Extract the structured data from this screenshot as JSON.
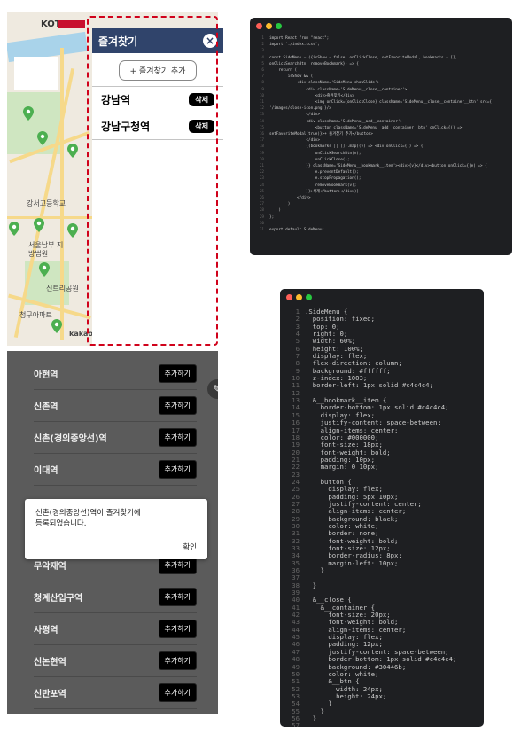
{
  "side_menu": {
    "title": "즐겨찾기",
    "close_icon": "close-icon",
    "add_button": "+ 즐겨찾기 추가",
    "favorites": [
      {
        "name": "강남역",
        "delete": "삭제"
      },
      {
        "name": "강남구청역",
        "delete": "삭제"
      }
    ]
  },
  "map": {
    "logo": "KOTI",
    "labels": [
      "강서고등학교",
      "서울남부 지방법원",
      "신트리공원",
      "청구아파트",
      "kakao"
    ]
  },
  "code_jsx": [
    "import React from \"react\";",
    "import './index.scss';",
    "",
    "const SideMenu = ({isShow = false, onClickClose, setFavoriteModal, bookmarks = [],",
    "onClickSearchBtn, removeBookmark}) => {",
    "    return (",
    "        isShow && (",
    "            <div className='SideMenu showSlide'>",
    "                <div className='SideMenu__close__container'>",
    "                    <div>즐겨찾기</div>",
    "                    <img onClick={onClickClose} className='SideMenu__close__container__btn' src={",
    "'/images/close-icon.png'}/>",
    "                </div>",
    "                <div className='SideMenu__add__container'>",
    "                    <button className='SideMenu__add__container__btn' onClick={() =>",
    "setFavoriteModal(true)}>+ 즐겨찾기 추가</button>",
    "                </div>",
    "                {(bookmarks || []).map((v) => <div onClick={() => {",
    "                    onClickSearchBtn(v);",
    "                    onClickClose();",
    "                }} className='SideMenu__bookmark__item'><div>{v}</div><button onClick={(e) => {",
    "                    e.preventDefault();",
    "                    e.stopPropagation();",
    "                    removeBookmark(v);",
    "                }}>삭제</button></div>)}",
    "            </div>",
    "        )",
    "    )",
    "};",
    "",
    "export default SideMenu;"
  ],
  "code_scss": [
    ".SideMenu {",
    "  position: fixed;",
    "  top: 0;",
    "  right: 0;",
    "  width: 60%;",
    "  height: 100%;",
    "  display: flex;",
    "  flex-direction: column;",
    "  background: #ffffff;",
    "  z-index: 1003;",
    "  border-left: 1px solid #c4c4c4;",
    "",
    "  &__bookmark__item {",
    "    border-bottom: 1px solid #c4c4c4;",
    "    display: flex;",
    "    justify-content: space-between;",
    "    align-items: center;",
    "    color: #000000;",
    "    font-size: 18px;",
    "    font-weight: bold;",
    "    padding: 10px;",
    "    margin: 0 10px;",
    "",
    "    button {",
    "      display: flex;",
    "      padding: 5px 10px;",
    "      justify-content: center;",
    "      align-items: center;",
    "      background: black;",
    "      color: white;",
    "      border: none;",
    "      font-weight: bold;",
    "      font-size: 12px;",
    "      border-radius: 8px;",
    "      margin-left: 10px;",
    "    }",
    "",
    "  }",
    "",
    "  &__close {",
    "    &__container {",
    "      font-size: 20px;",
    "      font-weight: bold;",
    "      align-items: center;",
    "      display: flex;",
    "      padding: 12px;",
    "      justify-content: space-between;",
    "      border-bottom: 1px solid #c4c4c4;",
    "      background: #30446b;",
    "      color: white;",
    "      &__btn {",
    "        width: 24px;",
    "        height: 24px;",
    "      }",
    "    }",
    "  }",
    ""
  ],
  "stations": [
    {
      "name": "아현역",
      "button": "추가하기"
    },
    {
      "name": "신촌역",
      "button": "추가하기"
    },
    {
      "name": "신촌(경의중앙선)역",
      "button": "추가하기"
    },
    {
      "name": "이대역",
      "button": "추가하기"
    },
    {
      "name": "무악재역",
      "button": "추가하기"
    },
    {
      "name": "청계산입구역",
      "button": "추가하기"
    },
    {
      "name": "사평역",
      "button": "추가하기"
    },
    {
      "name": "신논현역",
      "button": "추가하기"
    },
    {
      "name": "신반포역",
      "button": "추가하기"
    }
  ],
  "dialog": {
    "line1": "신촌(경의중앙선)역이 즐겨찾기에",
    "line2": "등록되었습니다.",
    "confirm": "확인"
  },
  "colors": {
    "header": "#30446b",
    "dash": "#d0021b",
    "editor_bg": "#1e1f22"
  }
}
